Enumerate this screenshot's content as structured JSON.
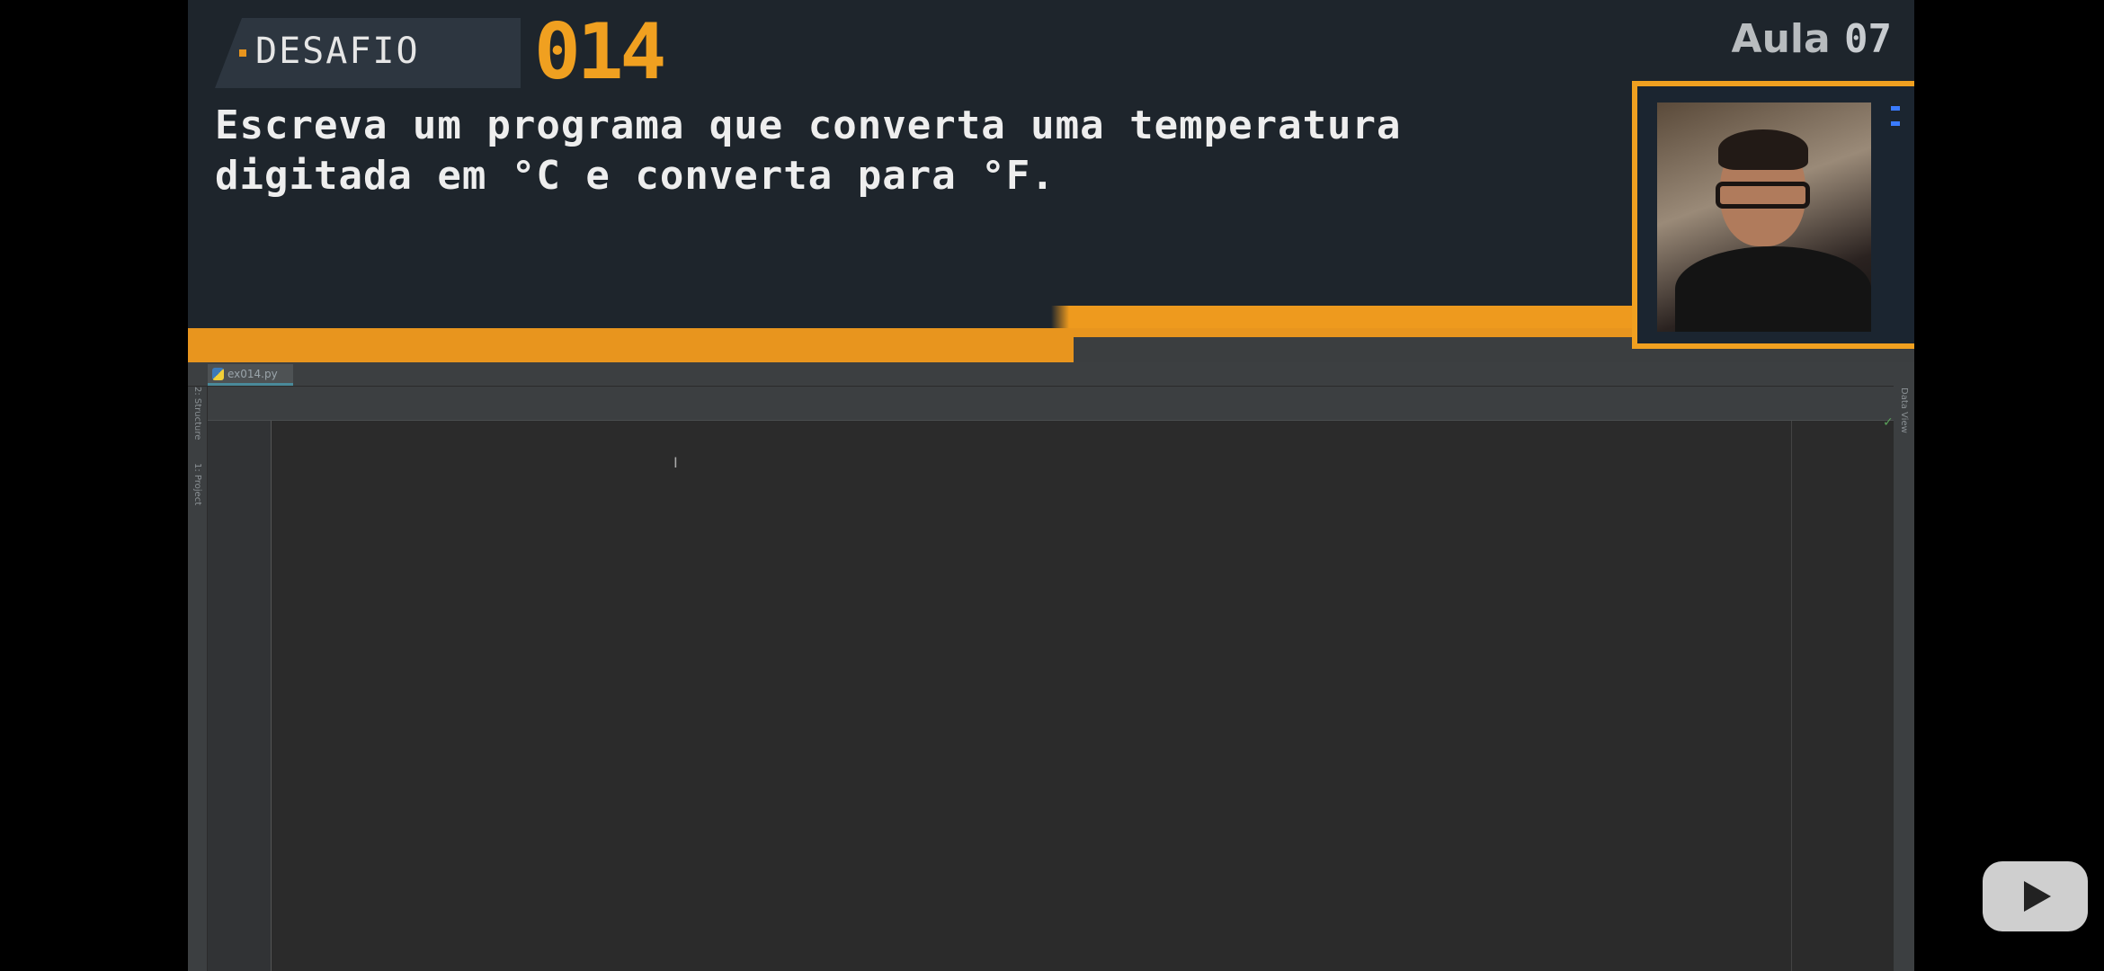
{
  "header": {
    "badge_label": "DESAFIO",
    "challenge_number": "014",
    "description_line1": "Escreva um programa que converta uma temperatura",
    "description_line2": "digitada em °C e converta para °F.",
    "lesson_label": "Aula",
    "lesson_number": "07"
  },
  "ide": {
    "tab_label": "ex014.py",
    "left_tools": [
      "2: Structure",
      "1: Project"
    ],
    "right_tools": [
      "Data View"
    ]
  },
  "colors": {
    "accent": "#f0a020",
    "header_bg": "#1e252c",
    "editor_bg": "#2b2b2b"
  }
}
